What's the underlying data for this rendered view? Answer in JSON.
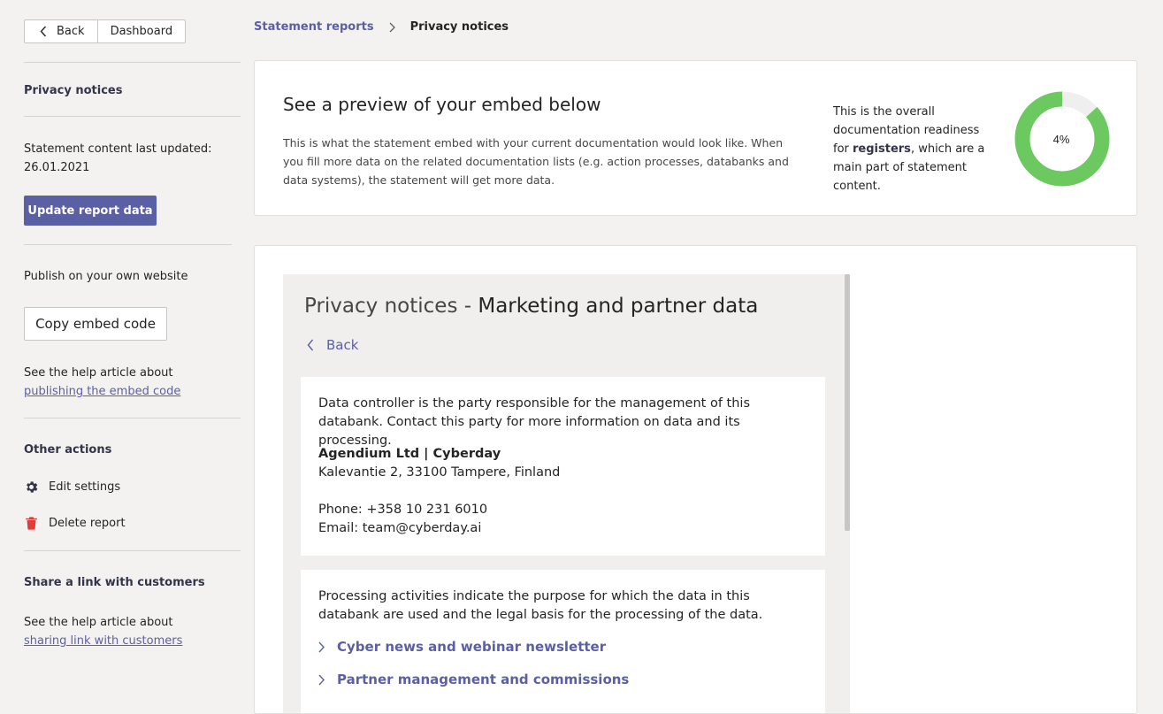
{
  "nav": {
    "back_label": "Back",
    "dashboard_label": "Dashboard"
  },
  "sidebar": {
    "section_title": "Privacy notices",
    "updated_label": "Statement content last updated:",
    "updated_date": "26.01.2021",
    "update_button": "Update report data",
    "publish_title": "Publish on your own website",
    "copy_button": "Copy embed code",
    "help1_prefix": "See the help article about",
    "help1_link": "publishing the embed code",
    "other_actions_title": "Other actions",
    "edit_settings": "Edit settings",
    "delete_report": "Delete report",
    "share_title": "Share a link with customers",
    "help2_prefix": "See the help article about",
    "help2_link": "sharing link with customers"
  },
  "breadcrumb": {
    "parent": "Statement reports",
    "current": "Privacy notices"
  },
  "preview": {
    "title": "See a preview of your embed below",
    "description": "This is what the statement embed with your current documentation would look like. When you fill more data on the related documentation lists (e.g. action processes, databanks and data systems), the statement will get more data.",
    "readiness_pre": "This is the overall documentation readiness for ",
    "readiness_bold": "registers",
    "readiness_post": ", which are a main part of statement content.",
    "readiness_value": 4,
    "readiness_label": "4%",
    "colors": {
      "filled": "#6cc95f",
      "empty": "#efefef",
      "accent": "#5b5fa4"
    }
  },
  "embed": {
    "title_prefix": "Privacy notices -",
    "title_main": "Marketing and partner data",
    "back_label": "Back",
    "controller_intro": "Data controller is the party responsible for the management of this databank. Contact this party for more information on data and its processing.",
    "company_name": "Agendium Ltd | Cyberday",
    "address": "Kalevantie 2, 33100 Tampere, Finland",
    "phone": "Phone: +358 10 231 6010",
    "email": "Email: team@cyberday.ai",
    "processing_intro": "Processing activities indicate the purpose for which the data in this databank are used and the legal basis for the processing of the data.",
    "activities": [
      "Cyber news and webinar newsletter",
      "Partner management and commissions"
    ]
  }
}
